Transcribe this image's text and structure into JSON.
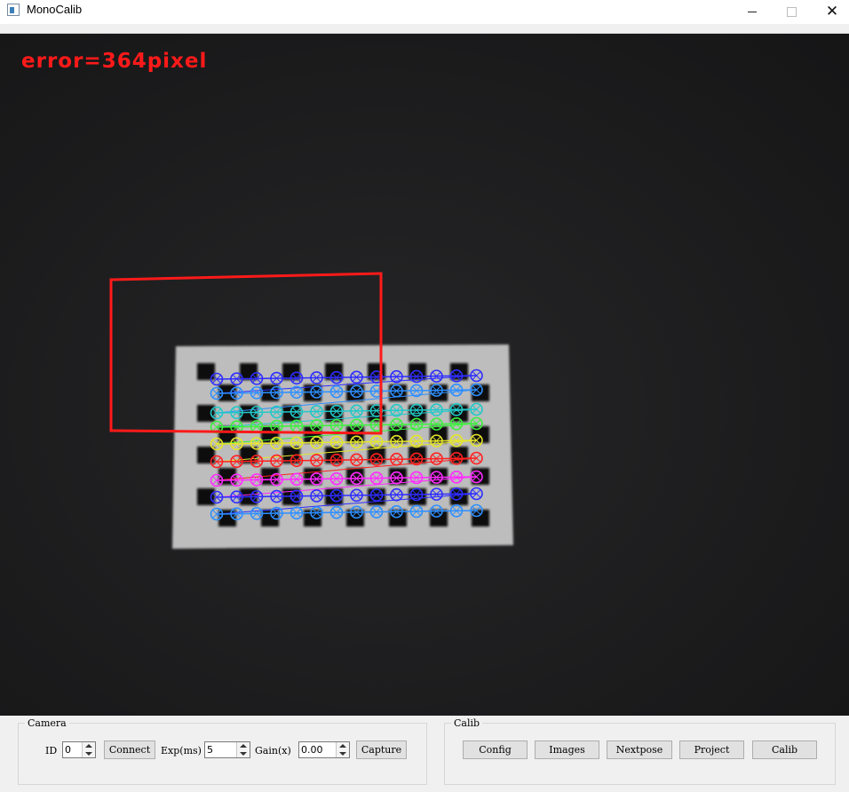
{
  "window": {
    "title": "MonoCalib",
    "close_glyph": "✕",
    "icons": [
      "app-icon",
      "minimize-icon",
      "maximize-icon",
      "close-icon"
    ]
  },
  "overlay": {
    "error_text": "error=364pixel",
    "error_color": "#ff1a1a",
    "roi_color": "#ff1a1a"
  },
  "camera": {
    "group_title": "Camera",
    "id_label": "ID",
    "id_value": "0",
    "connect_label": "Connect",
    "exposure_label": "Exp(ms)",
    "exposure_value": "5",
    "gain_label": "Gain(x)",
    "gain_value": "0.00",
    "capture_label": "Capture"
  },
  "calib": {
    "group_title": "Calib",
    "buttons": [
      "Config",
      "Images",
      "Nextpose",
      "Project",
      "Calib"
    ]
  },
  "detected_pattern": {
    "row_colors": [
      "#2d2dff",
      "#2d8fff",
      "#22c8c8",
      "#3cf03c",
      "#e6e62a",
      "#ff2020",
      "#ff2aff",
      "#2d2dff",
      "#2d8fff"
    ]
  }
}
